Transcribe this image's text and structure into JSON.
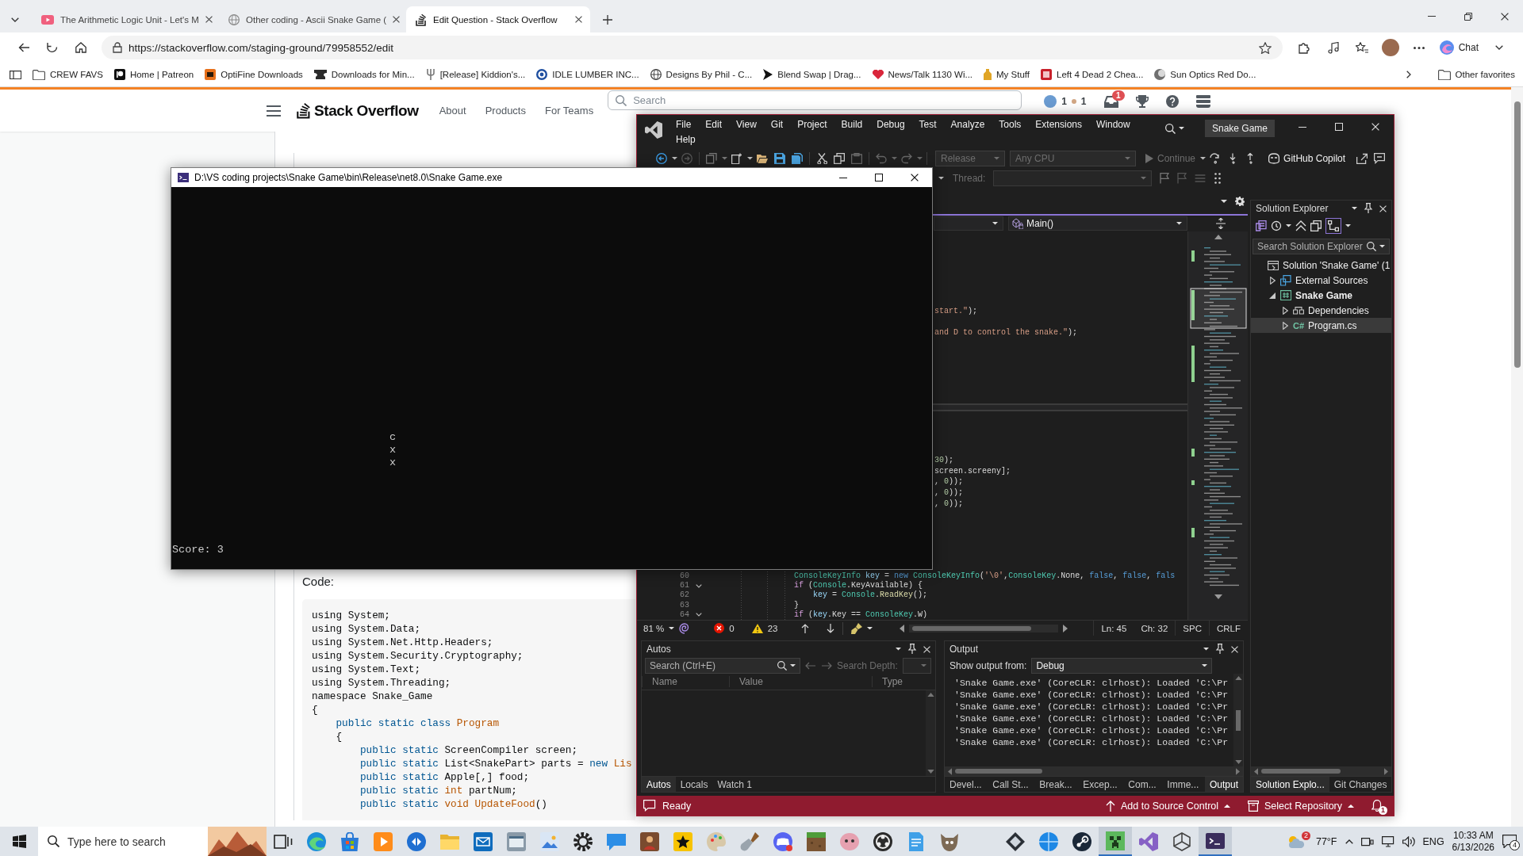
{
  "browser": {
    "tabs": [
      {
        "title": "The Arithmetic Logic Unit - Let's M",
        "kind": "video",
        "selected": false
      },
      {
        "title": "Other coding - Ascii Snake Game (",
        "kind": "globe",
        "selected": false
      },
      {
        "title": "Edit Question - Stack Overflow",
        "kind": "stack",
        "selected": true
      }
    ],
    "address": "https://stackoverflow.com/staging-ground/79958552/edit",
    "chat_button": "Chat",
    "bookmarks": [
      {
        "label": "CREW FAVS",
        "kind": "folder"
      },
      {
        "label": "Home | Patreon",
        "kind": "patreon"
      },
      {
        "label": "OptiFine Downloads",
        "kind": "orange-tile"
      },
      {
        "label": "Downloads for Min...",
        "kind": "anvil"
      },
      {
        "label": "[Release] Kiddion's...",
        "kind": "fork"
      },
      {
        "label": "IDLE LUMBER INC...",
        "kind": "ring"
      },
      {
        "label": "Designs By Phil - C...",
        "kind": "globe"
      },
      {
        "label": "Blend Swap | Drag...",
        "kind": "arrow"
      },
      {
        "label": "News/Talk 1130 Wi...",
        "kind": "heart"
      },
      {
        "label": "My Stuff",
        "kind": "bottle"
      },
      {
        "label": "Left 4 Dead 2 Chea...",
        "kind": "red-tile"
      },
      {
        "label": "Sun Optics Red Do...",
        "kind": "moon"
      }
    ],
    "other_favorites": "Other favorites"
  },
  "stackoverflow": {
    "logo_text": "Stack Overflow",
    "nav": [
      "About",
      "Products",
      "For Teams"
    ],
    "search_placeholder": "Search",
    "reputation": "1",
    "badge_count": "1",
    "inbox_badge": "1",
    "code_label": "Code:",
    "code_lines": [
      [
        {
          "kind": "plain",
          "text": "using System;"
        }
      ],
      [
        {
          "kind": "plain",
          "text": "using System.Data;"
        }
      ],
      [
        {
          "kind": "plain",
          "text": "using System.Net.Http.Headers;"
        }
      ],
      [
        {
          "kind": "plain",
          "text": "using System.Security.Cryptography;"
        }
      ],
      [
        {
          "kind": "plain",
          "text": "using System.Text;"
        }
      ],
      [
        {
          "kind": "plain",
          "text": "using System.Threading;"
        }
      ],
      [
        {
          "kind": "plain",
          "text": "namespace Snake_Game"
        }
      ],
      [
        {
          "kind": "plain",
          "text": "{"
        }
      ],
      [
        {
          "kind": "keyword",
          "text": "    public static class"
        },
        {
          "kind": "title",
          "text": " Program"
        }
      ],
      [
        {
          "kind": "plain",
          "text": "    {"
        }
      ],
      [
        {
          "kind": "keyword",
          "text": "        public static"
        },
        {
          "kind": "plain",
          "text": " ScreenCompiler screen;"
        }
      ],
      [
        {
          "kind": "keyword",
          "text": "        public static"
        },
        {
          "kind": "plain",
          "text": " List<SnakePart> parts = "
        },
        {
          "kind": "keyword",
          "text": "new"
        },
        {
          "kind": "title",
          "text": " Lis"
        }
      ],
      [
        {
          "kind": "keyword",
          "text": "        public static"
        },
        {
          "kind": "plain",
          "text": " Apple[,] food;"
        }
      ],
      [
        {
          "kind": "keyword",
          "text": "        public static"
        },
        {
          "kind": "title",
          "text": " int"
        },
        {
          "kind": "plain",
          "text": " partNum;"
        }
      ],
      [
        {
          "kind": "keyword",
          "text": "        public static"
        },
        {
          "kind": "title",
          "text": " void UpdateFood"
        },
        {
          "kind": "plain",
          "text": "()"
        }
      ]
    ]
  },
  "vs": {
    "menu": [
      "File",
      "Edit",
      "View",
      "Git",
      "Project",
      "Build",
      "Debug",
      "Test",
      "Analyze",
      "Tools",
      "Extensions",
      "Window",
      "Help"
    ],
    "title": "Snake Game",
    "toolbar": {
      "configuration": {
        "value": "Release",
        "disabled": true
      },
      "platform": {
        "value": "Any CPU",
        "disabled": true
      },
      "continue": {
        "label": "Continue",
        "disabled": true
      },
      "copilot": "GitHub Copilot",
      "thread": {
        "label": "Thread:",
        "disabled": true
      }
    },
    "navigation": {
      "member": "Main()"
    },
    "editor": {
      "upper": [
        [
          {
            "kind": "string",
            "text": "start.\""
          },
          {
            "kind": "plain",
            "text": ");"
          }
        ],
        [
          {
            "kind": "string",
            "text": "and D to control the snake.\""
          },
          {
            "kind": "plain",
            "text": ");"
          }
        ]
      ],
      "lower": [
        [
          {
            "kind": "number",
            "text": "30"
          },
          {
            "kind": "plain",
            "text": ");"
          }
        ],
        [
          {
            "kind": "plain",
            "text": "screen.screeny];"
          }
        ],
        [
          {
            "kind": "plain",
            "text": ", "
          },
          {
            "kind": "number",
            "text": "0"
          },
          {
            "kind": "plain",
            "text": "));"
          }
        ],
        [
          {
            "kind": "plain",
            "text": ", "
          },
          {
            "kind": "number",
            "text": "0"
          },
          {
            "kind": "plain",
            "text": "));"
          }
        ],
        [
          {
            "kind": "plain",
            "text": ", "
          },
          {
            "kind": "number",
            "text": "0"
          },
          {
            "kind": "plain",
            "text": "));"
          }
        ]
      ],
      "lines": [
        {
          "number": "60",
          "foldable": false,
          "tokens": [
            {
              "kind": "type",
              "text": "                ConsoleKeyInfo"
            },
            {
              "kind": "variable",
              "text": " key"
            },
            {
              "kind": "plain",
              "text": " = "
            },
            {
              "kind": "keyword",
              "text": "new"
            },
            {
              "kind": "type",
              "text": " ConsoleKeyInfo"
            },
            {
              "kind": "plain",
              "text": "("
            },
            {
              "kind": "string",
              "text": "'\\0'"
            },
            {
              "kind": "plain",
              "text": ","
            },
            {
              "kind": "type",
              "text": "ConsoleKey"
            },
            {
              "kind": "plain",
              "text": ".None, "
            },
            {
              "kind": "keyword",
              "text": "false"
            },
            {
              "kind": "plain",
              "text": ", "
            },
            {
              "kind": "keyword",
              "text": "false"
            },
            {
              "kind": "plain",
              "text": ", "
            },
            {
              "kind": "keyword",
              "text": "fals"
            }
          ]
        },
        {
          "number": "61",
          "foldable": true,
          "tokens": [
            {
              "kind": "control",
              "text": "                if"
            },
            {
              "kind": "plain",
              "text": " ("
            },
            {
              "kind": "type",
              "text": "Console"
            },
            {
              "kind": "plain",
              "text": ".KeyAvailable) {"
            }
          ]
        },
        {
          "number": "62",
          "foldable": false,
          "tokens": [
            {
              "kind": "variable",
              "text": "                    key"
            },
            {
              "kind": "plain",
              "text": " = "
            },
            {
              "kind": "type",
              "text": "Console"
            },
            {
              "kind": "plain",
              "text": "."
            },
            {
              "kind": "method",
              "text": "ReadKey"
            },
            {
              "kind": "plain",
              "text": "();"
            }
          ]
        },
        {
          "number": "63",
          "foldable": false,
          "tokens": [
            {
              "kind": "plain",
              "text": "                }"
            }
          ]
        },
        {
          "number": "64",
          "foldable": true,
          "tokens": [
            {
              "kind": "control",
              "text": "                if"
            },
            {
              "kind": "plain",
              "text": " ("
            },
            {
              "kind": "variable",
              "text": "key"
            },
            {
              "kind": "plain",
              "text": ".Key == "
            },
            {
              "kind": "type",
              "text": "ConsoleKey"
            },
            {
              "kind": "plain",
              "text": ".W)"
            }
          ]
        }
      ]
    },
    "editor_status": {
      "zoom": "81 %",
      "errors": "0",
      "warnings": "23",
      "line": "Ln: 45",
      "column": "Ch: 32",
      "whitespace": "SPC",
      "line_ending": "CRLF"
    },
    "solution_explorer": {
      "title": "Solution Explorer",
      "search_placeholder": "Search Solution Explorer",
      "tree": [
        {
          "label": "Solution 'Snake Game' (1",
          "kind": "solution",
          "selected": false,
          "children": [
            {
              "label": "External Sources",
              "kind": "external",
              "expanded": false,
              "selected": false
            },
            {
              "label": "Snake Game",
              "kind": "project",
              "expanded": true,
              "selected": false,
              "children": [
                {
                  "label": "Dependencies",
                  "kind": "dependencies",
                  "expanded": false,
                  "selected": false
                },
                {
                  "label": "Program.cs",
                  "kind": "source",
                  "icon_text": "C#",
                  "expanded": false,
                  "selected": true
                }
              ]
            }
          ]
        }
      ],
      "tabs": [
        {
          "label": "Solution Explo...",
          "selected": true
        },
        {
          "label": "Git Changes",
          "selected": false
        }
      ]
    },
    "autos": {
      "title": "Autos",
      "search_placeholder": "Search (Ctrl+E)",
      "search_depth_label": "Search Depth:",
      "columns": [
        "Name",
        "Value",
        "Type"
      ],
      "tabs": [
        {
          "label": "Autos",
          "selected": true
        },
        {
          "label": "Locals",
          "selected": false
        },
        {
          "label": "Watch 1",
          "selected": false
        }
      ]
    },
    "output": {
      "title": "Output",
      "source_label": "Show output from:",
      "source": "Debug",
      "lines": [
        "'Snake Game.exe' (CoreCLR: clrhost): Loaded 'C:\\Pr",
        "'Snake Game.exe' (CoreCLR: clrhost): Loaded 'C:\\Pr",
        "'Snake Game.exe' (CoreCLR: clrhost): Loaded 'C:\\Pr",
        "'Snake Game.exe' (CoreCLR: clrhost): Loaded 'C:\\Pr",
        "'Snake Game.exe' (CoreCLR: clrhost): Loaded 'C:\\Pr",
        "'Snake Game.exe' (CoreCLR: clrhost): Loaded 'C:\\Pr"
      ],
      "tabs": [
        {
          "label": "Devel...",
          "selected": false
        },
        {
          "label": "Call St...",
          "selected": false
        },
        {
          "label": "Break...",
          "selected": false
        },
        {
          "label": "Excep...",
          "selected": false
        },
        {
          "label": "Com...",
          "selected": false
        },
        {
          "label": "Imme...",
          "selected": false
        },
        {
          "label": "Output",
          "selected": true
        }
      ]
    },
    "status": {
      "text": "Ready",
      "source_control": "Add to Source Control",
      "repository": "Select Repository",
      "notifications": "1"
    }
  },
  "console": {
    "title": "D:\\VS coding projects\\Snake Game\\bin\\Release\\net8.0\\Snake Game.exe",
    "snake": [
      "c",
      "x",
      "x"
    ],
    "score": "Score: 3"
  },
  "taskbar": {
    "search_placeholder": "Type here to search",
    "apps": [
      {
        "kind": "task-view",
        "selected": false
      },
      {
        "kind": "browser",
        "selected": false
      },
      {
        "kind": "store",
        "selected": false
      },
      {
        "kind": "media",
        "selected": false
      },
      {
        "kind": "disc",
        "selected": false
      },
      {
        "kind": "folder",
        "selected": false
      },
      {
        "kind": "mail",
        "selected": false
      },
      {
        "kind": "window",
        "selected": false
      },
      {
        "kind": "picture",
        "selected": false
      },
      {
        "kind": "gear",
        "selected": false
      },
      {
        "kind": "chat",
        "selected": false
      },
      {
        "kind": "game",
        "selected": false
      },
      {
        "kind": "star-tile",
        "selected": false
      },
      {
        "kind": "palette",
        "selected": false
      },
      {
        "kind": "shovel",
        "selected": false
      },
      {
        "kind": "controller",
        "selected": false
      },
      {
        "kind": "block",
        "selected": false
      },
      {
        "kind": "blob",
        "selected": false
      },
      {
        "kind": "ring",
        "selected": false
      },
      {
        "kind": "document",
        "selected": false
      },
      {
        "kind": "face",
        "selected": false
      },
      {
        "kind": "diamond",
        "selected": false
      },
      {
        "kind": "sphere",
        "selected": false
      },
      {
        "kind": "knob",
        "selected": false
      },
      {
        "kind": "creeper",
        "selected": true
      },
      {
        "kind": "ribbon",
        "selected": false
      },
      {
        "kind": "cube",
        "selected": false
      },
      {
        "kind": "terminal",
        "selected": true
      }
    ],
    "weather": "77°F",
    "weather_badge": "2",
    "language": "ENG",
    "time": "10:33 AM",
    "date": "6/13/2026",
    "notifications": "4"
  }
}
